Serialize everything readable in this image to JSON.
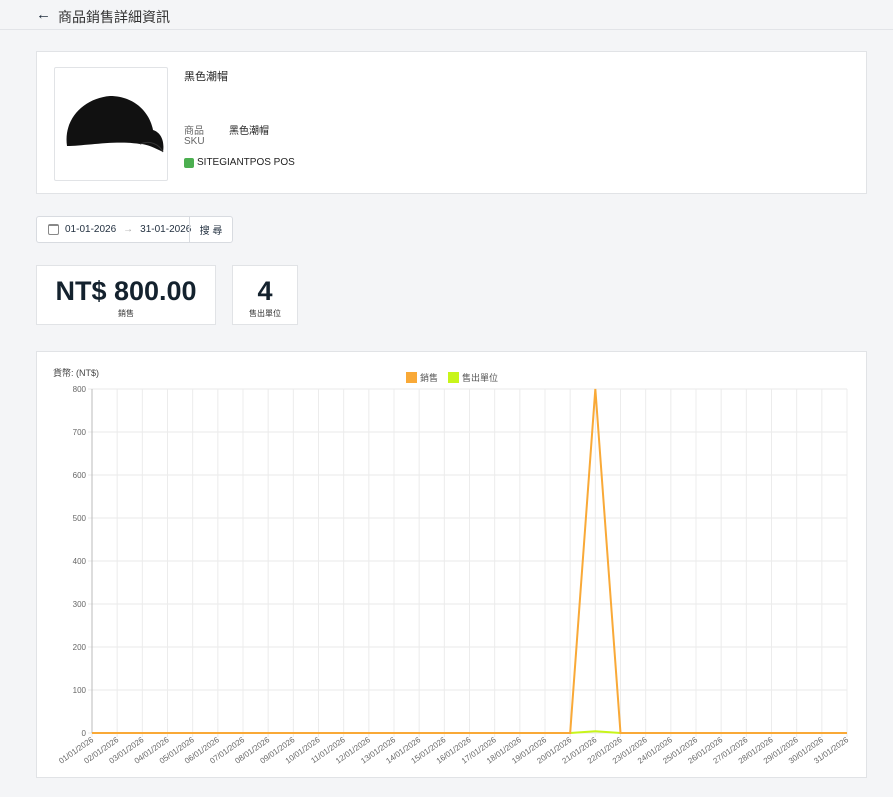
{
  "header": {
    "title": "商品銷售詳細資訊"
  },
  "product": {
    "name": "黑色潮帽",
    "product_label": "商品",
    "product_value": "黑色潮帽",
    "sku_label": "SKU",
    "channel": "SITEGIANTPOS  POS"
  },
  "filter": {
    "start_date": "01-01-2026",
    "arrow": "→",
    "end_date": "31-01-2026",
    "search_label": "搜 尋"
  },
  "kpis": [
    {
      "value": "NT$ 800.00",
      "label": "銷售"
    },
    {
      "value": "4",
      "label": "售出單位"
    }
  ],
  "chart_data": {
    "type": "line",
    "currency_label": "貨幣: (NT$)",
    "x": [
      "01/01/2026",
      "02/01/2026",
      "03/01/2026",
      "04/01/2026",
      "05/01/2026",
      "06/01/2026",
      "07/01/2026",
      "08/01/2026",
      "09/01/2026",
      "10/01/2026",
      "11/01/2026",
      "12/01/2026",
      "13/01/2026",
      "14/01/2026",
      "15/01/2026",
      "16/01/2026",
      "17/01/2026",
      "18/01/2026",
      "19/01/2026",
      "20/01/2026",
      "21/01/2026",
      "22/01/2026",
      "23/01/2026",
      "24/01/2026",
      "25/01/2026",
      "26/01/2026",
      "27/01/2026",
      "28/01/2026",
      "29/01/2026",
      "30/01/2026",
      "31/01/2026"
    ],
    "series": [
      {
        "name": "銷售",
        "color": "#f9a937",
        "values": [
          0,
          0,
          0,
          0,
          0,
          0,
          0,
          0,
          0,
          0,
          0,
          0,
          0,
          0,
          0,
          0,
          0,
          0,
          0,
          0,
          800,
          0,
          0,
          0,
          0,
          0,
          0,
          0,
          0,
          0,
          0
        ]
      },
      {
        "name": "售出單位",
        "color": "#c8f51a",
        "values": [
          0,
          0,
          0,
          0,
          0,
          0,
          0,
          0,
          0,
          0,
          0,
          0,
          0,
          0,
          0,
          0,
          0,
          0,
          0,
          0,
          4,
          0,
          0,
          0,
          0,
          0,
          0,
          0,
          0,
          0,
          0
        ]
      }
    ],
    "ylim": [
      0,
      800
    ],
    "yticks": [
      0,
      100,
      200,
      300,
      400,
      500,
      600,
      700,
      800
    ],
    "legend": "top-center",
    "grid": true
  }
}
